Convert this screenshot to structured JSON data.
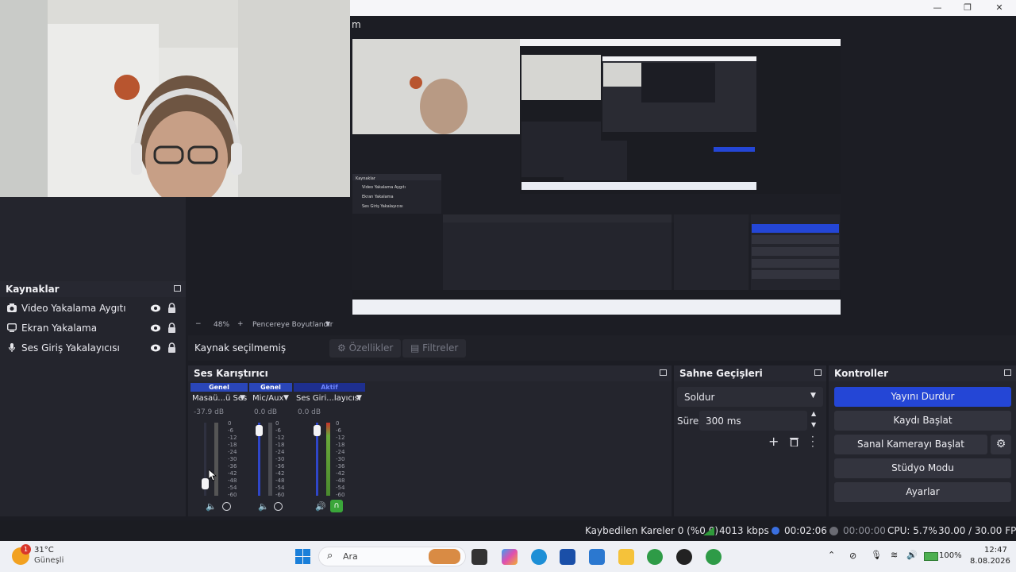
{
  "window": {
    "menu_stub": "m",
    "minimize": "—",
    "restore": "❐",
    "close": "✕"
  },
  "sources": {
    "title": "Kaynaklar",
    "items": [
      {
        "label": "Video Yakalama Aygıtı",
        "icon": "camera-icon"
      },
      {
        "label": "Ekran Yakalama",
        "icon": "monitor-icon"
      },
      {
        "label": "Ses Giriş Yakalayıcısı",
        "icon": "microphone-icon"
      }
    ]
  },
  "preview_toolbar": {
    "minus": "−",
    "zoom": "48%",
    "plus": "+",
    "fit_label": "Pencereye Boyutlandır"
  },
  "scene_bar": {
    "no_source": "Kaynak seçilmemiş",
    "properties": "Özellikler",
    "filters": "Filtreler"
  },
  "mixer": {
    "title": "Ses Karıştırıcı",
    "channels": [
      {
        "mode": "Genel",
        "name": "Masaü...ü Ses",
        "db": "-37.9 dB",
        "level": 0.22
      },
      {
        "mode": "Genel",
        "name": "Mic/Aux",
        "db": "0.0 dB",
        "level": 0.95
      },
      {
        "mode": "Aktif",
        "name": "Ses Giri...layıcısı",
        "db": "0.0 dB",
        "level": 0.95
      }
    ],
    "scale": [
      "0",
      "-6",
      "-12",
      "-18",
      "-24",
      "-30",
      "-36",
      "-42",
      "-48",
      "-54",
      "-60"
    ],
    "colors": {
      "genel": "#2a46b8",
      "aktif": "#1e2f8e"
    }
  },
  "transitions": {
    "title": "Sahne Geçişleri",
    "selected": "Soldur",
    "duration_label": "Süre",
    "duration": "300 ms"
  },
  "controls": {
    "title": "Kontroller",
    "stop_stream": "Yayını Durdur",
    "start_record": "Kaydı Başlat",
    "virtual_cam": "Sanal Kamerayı Başlat",
    "studio_mode": "Stüdyo Modu",
    "settings": "Ayarlar",
    "accent": "#2446d6"
  },
  "status": {
    "dropped": "Kaybedilen Kareler 0 (%0.0)",
    "bitrate": "4013 kbps",
    "stream_time": "00:02:06",
    "record_time": "00:00:00",
    "cpu": "CPU: 5.7%",
    "fps": "30.00 / 30.00 FPS"
  },
  "taskbar": {
    "weather_temp": "31°C",
    "weather_desc": "Güneşli",
    "badge": "1",
    "search": "Ara",
    "battery": "100%",
    "time": "12:47",
    "date": "8.08.2026"
  }
}
